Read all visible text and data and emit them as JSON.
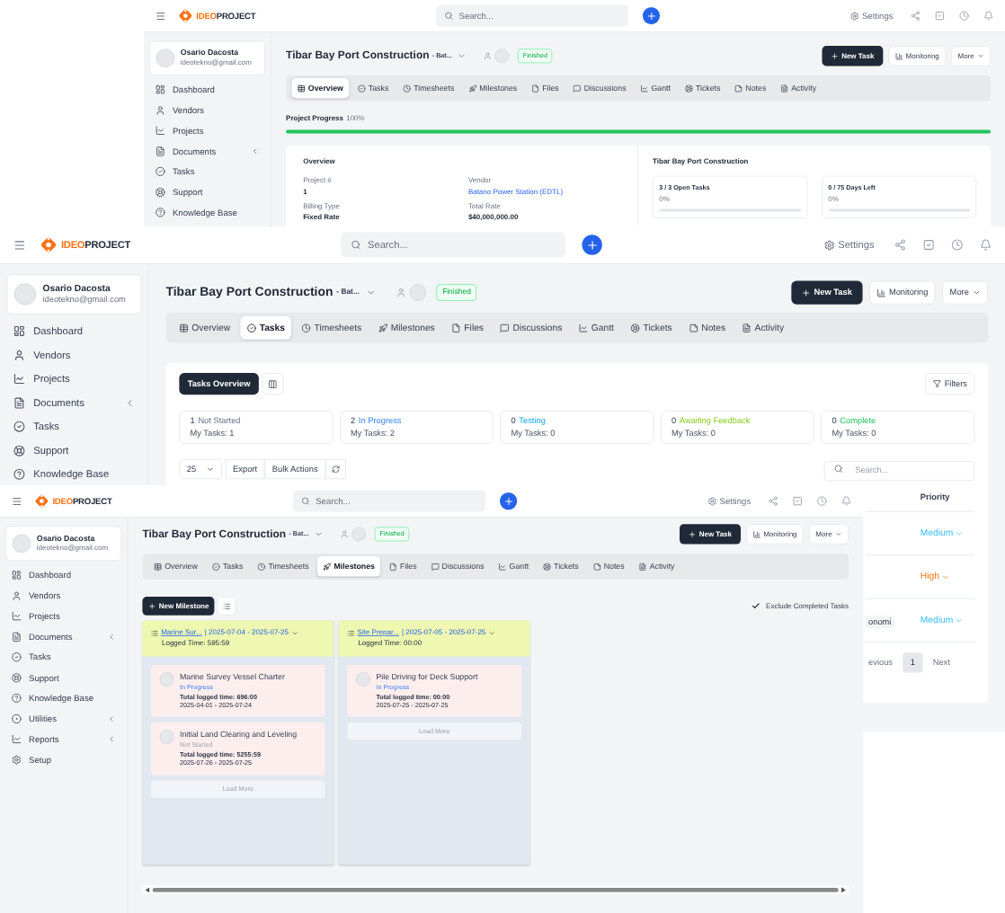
{
  "shots": [
    {
      "kind": "overview",
      "logo": [
        "IDEO",
        "PROJECT"
      ],
      "search_placeholder": "Search...",
      "settings": "Settings",
      "user": {
        "name": "Osario Dacosta",
        "email": "ideotekno@gmail.com"
      },
      "sidebar": [
        {
          "label": "Dashboard",
          "submenu": false
        },
        {
          "label": "Vendors",
          "submenu": false
        },
        {
          "label": "Projects",
          "submenu": false
        },
        {
          "label": "Documents",
          "submenu": true
        },
        {
          "label": "Tasks",
          "submenu": false
        },
        {
          "label": "Support",
          "submenu": false
        },
        {
          "label": "Knowledge Base",
          "submenu": false
        }
      ],
      "title": "Tibar Bay Port Construction",
      "subtitle": "- Bat...",
      "status": "Finished",
      "buttons": {
        "new_task": "New Task",
        "monitoring": "Monitoring",
        "more": "More"
      },
      "tabs": [
        {
          "label": "Overview",
          "selected": true
        },
        {
          "label": "Tasks",
          "selected": false
        },
        {
          "label": "Timesheets",
          "selected": false
        },
        {
          "label": "Milestones",
          "selected": false
        },
        {
          "label": "Files",
          "selected": false
        },
        {
          "label": "Discussions",
          "selected": false
        },
        {
          "label": "Gantt",
          "selected": false
        },
        {
          "label": "Tickets",
          "selected": false
        },
        {
          "label": "Notes",
          "selected": false
        },
        {
          "label": "Activity",
          "selected": false
        }
      ],
      "progress": {
        "label": "Project Progress",
        "value": "100%",
        "level": 1
      },
      "overview": {
        "title": "Overview",
        "fields": [
          {
            "label": "Project #",
            "value": "1",
            "link": false
          },
          {
            "label": "Vendor",
            "value": "Batano Power Station (EDTL)",
            "link": true
          },
          {
            "label": "Billing Type",
            "value": "Fixed Rate",
            "link": false
          },
          {
            "label": "Total Rate",
            "value": "$40,000,000.00",
            "link": false
          }
        ]
      },
      "summary": {
        "title": "Tibar Bay Port Construction",
        "stats": [
          {
            "label": "3 / 3 Open Tasks",
            "value": "0%",
            "level": 0
          },
          {
            "label": "0 / 75 Days Left",
            "value": "0%",
            "level": 0
          }
        ]
      }
    },
    {
      "kind": "tasks",
      "logo": [
        "IDEO",
        "PROJECT"
      ],
      "search_placeholder": "Search...",
      "settings": "Settings",
      "user": {
        "name": "Osario Dacosta",
        "email": "ideotekno@gmail.com"
      },
      "sidebar": [
        {
          "label": "Dashboard",
          "submenu": false
        },
        {
          "label": "Vendors",
          "submenu": false
        },
        {
          "label": "Projects",
          "submenu": false
        },
        {
          "label": "Documents",
          "submenu": true
        },
        {
          "label": "Tasks",
          "submenu": false
        },
        {
          "label": "Support",
          "submenu": false
        },
        {
          "label": "Knowledge Base",
          "submenu": false
        }
      ],
      "title": "Tibar Bay Port Construction",
      "subtitle": "- Bat...",
      "status": "Finished",
      "buttons": {
        "new_task": "New Task",
        "monitoring": "Monitoring",
        "more": "More"
      },
      "tabs": [
        {
          "label": "Overview",
          "selected": false
        },
        {
          "label": "Tasks",
          "selected": true
        },
        {
          "label": "Timesheets",
          "selected": false
        },
        {
          "label": "Milestones",
          "selected": false
        },
        {
          "label": "Files",
          "selected": false
        },
        {
          "label": "Discussions",
          "selected": false
        },
        {
          "label": "Gantt",
          "selected": false
        },
        {
          "label": "Tickets",
          "selected": false
        },
        {
          "label": "Notes",
          "selected": false
        },
        {
          "label": "Activity",
          "selected": false
        }
      ],
      "tasks": {
        "overview_button": "Tasks Overview",
        "filters": "Filters",
        "statuses": [
          {
            "count": "1",
            "label": "Not Started",
            "mine": "My Tasks: 1",
            "kind": "not_started"
          },
          {
            "count": "2",
            "label": "In Progress",
            "mine": "My Tasks: 2",
            "kind": "in_progress"
          },
          {
            "count": "0",
            "label": "Testing",
            "mine": "My Tasks: 0",
            "kind": "testing"
          },
          {
            "count": "0",
            "label": "Awaiting Feedback",
            "mine": "My Tasks: 0",
            "kind": "awaiting"
          },
          {
            "count": "0",
            "label": "Complete",
            "mine": "My Tasks: 0",
            "kind": "complete"
          }
        ],
        "page_size": "25",
        "export": "Export",
        "bulk": "Bulk Actions",
        "search_placeholder": "Search...",
        "priority_header": "Priority",
        "rows": [
          {
            "priority": "Medium",
            "kind": "medium"
          },
          {
            "priority": "High",
            "kind": "high"
          },
          {
            "priority": "Medium",
            "kind": "medium",
            "tag": "onomi"
          }
        ],
        "pagination": {
          "previous": "evious",
          "pages": [
            {
              "label": "1",
              "selected": true
            }
          ],
          "next": "Next"
        }
      }
    },
    {
      "kind": "milestones",
      "logo": [
        "IDEO",
        "PROJECT"
      ],
      "search_placeholder": "Search...",
      "settings": "Settings",
      "user": {
        "name": "Osario Dacosta",
        "email": "ideotekno@gmail.com"
      },
      "sidebar": [
        {
          "label": "Dashboard",
          "submenu": false
        },
        {
          "label": "Vendors",
          "submenu": false
        },
        {
          "label": "Projects",
          "submenu": false
        },
        {
          "label": "Documents",
          "submenu": true
        },
        {
          "label": "Tasks",
          "submenu": false
        },
        {
          "label": "Support",
          "submenu": false
        },
        {
          "label": "Knowledge Base",
          "submenu": false
        },
        {
          "label": "Utilities",
          "submenu": true
        },
        {
          "label": "Reports",
          "submenu": true
        },
        {
          "label": "Setup",
          "submenu": false
        }
      ],
      "title": "Tibar Bay Port Construction",
      "subtitle": "- Bat...",
      "status": "Finished",
      "buttons": {
        "new_task": "New Task",
        "monitoring": "Monitoring",
        "more": "More"
      },
      "tabs": [
        {
          "label": "Overview",
          "selected": false
        },
        {
          "label": "Tasks",
          "selected": false
        },
        {
          "label": "Timesheets",
          "selected": false
        },
        {
          "label": "Milestones",
          "selected": true
        },
        {
          "label": "Files",
          "selected": false
        },
        {
          "label": "Discussions",
          "selected": false
        },
        {
          "label": "Gantt",
          "selected": false
        },
        {
          "label": "Tickets",
          "selected": false
        },
        {
          "label": "Notes",
          "selected": false
        },
        {
          "label": "Activity",
          "selected": false
        }
      ],
      "milestones": {
        "new_button": "New Milestone",
        "exclude": {
          "label": "Exclude Completed Tasks",
          "checked": true
        },
        "columns": [
          {
            "name": "Marine Sur...",
            "dates": "| 2025-07-04 - 2025-07-25",
            "logged": "Logged Time: 595:59",
            "load_more": "Load More",
            "cards": [
              {
                "title": "Marine Survey Vessel Charter",
                "status": "In Progress",
                "kind": "in_progress",
                "logged": "Total logged time: 696:00",
                "dates": "2025-04-01 - 2025-07-24"
              },
              {
                "title": "Initial Land Clearing and Leveling",
                "status": "Not Started",
                "kind": "not_started",
                "logged": "Total logged time: 5255:59",
                "dates": "2025-07-26 - 2025-07-25"
              }
            ]
          },
          {
            "name": "Site Prepar...",
            "dates": "| 2025-07-05 - 2025-07-25",
            "logged": "Logged Time: 00:00",
            "load_more": "Load More",
            "cards": [
              {
                "title": "Pile Driving for Deck Support",
                "status": "In Progress",
                "kind": "in_progress",
                "logged": "Total logged time: 00:00",
                "dates": "2025-07-25 - 2025-07-25"
              }
            ]
          }
        ]
      }
    }
  ]
}
